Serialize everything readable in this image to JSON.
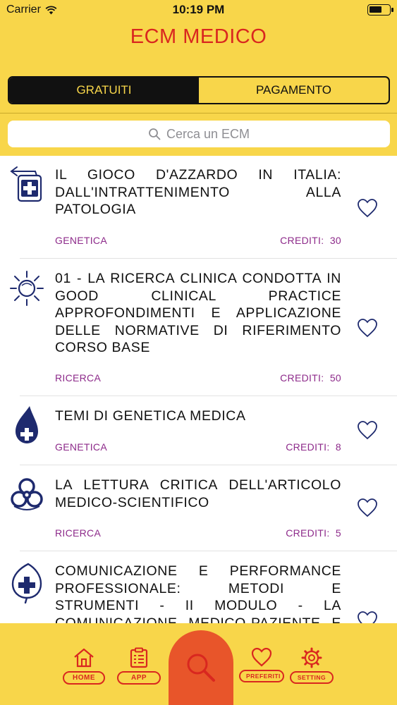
{
  "status_bar": {
    "carrier": "Carrier",
    "time": "10:19 PM"
  },
  "header": {
    "title": "ECM MEDICO"
  },
  "segmented": {
    "left": "GRATUITI",
    "right": "PAGAMENTO",
    "active": "left"
  },
  "search": {
    "placeholder": "Cerca un ECM"
  },
  "courses": [
    {
      "title": "IL GIOCO D'AZZARDO IN ITALIA: DALL'INTRATTENIMENTO ALLA PATOLOGIA",
      "category": "GENETICA",
      "credits_label": "CREDITI:",
      "credits": "30",
      "icon": "medical-box-icon"
    },
    {
      "title": "01 - LA RICERCA CLINICA CONDOTTA IN GOOD CLINICAL PRACTICE APPROFONDIMENTI E APPLICAZIONE DELLE NORMATIVE DI RIFERIMENTO CORSO BASE",
      "category": "RICERCA",
      "credits_label": "CREDITI:",
      "credits": "50",
      "icon": "sun-icon"
    },
    {
      "title": "TEMI DI GENETICA MEDICA",
      "category": "GENETICA",
      "credits_label": "CREDITI:",
      "credits": "8",
      "icon": "medical-drop-icon"
    },
    {
      "title": "LA LETTURA CRITICA DELL'ARTICOLO MEDICO-SCIENTIFICO",
      "category": "RICERCA",
      "credits_label": "CREDITI:",
      "credits": "5",
      "icon": "biohazard-icon"
    },
    {
      "title": "COMUNICAZIONE E PERFORMANCE PROFESSIONALE: METODI E STRUMENTI - II MODULO - LA COMUNICAZIONE MEDICO-PAZIENTE E TRA OPERATORI",
      "category": "",
      "credits_label": "",
      "credits": "",
      "icon": "medical-leaf-icon"
    }
  ],
  "tabbar": {
    "home": "HOME",
    "app": "APP",
    "search": "search-icon",
    "preferiti": "PREFERITI",
    "setting": "SETTING"
  },
  "colors": {
    "yellow": "#F8D64A",
    "title_red": "#D9271F",
    "category_purple": "#8D2A8A",
    "search_orange": "#E8552A",
    "icon_navy": "#1E2A6E"
  }
}
